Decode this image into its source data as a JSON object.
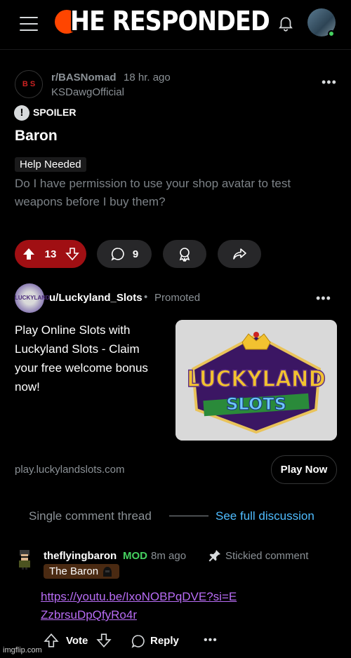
{
  "meme_caption": "HE RESPONDED",
  "post": {
    "subreddit": "r/BASNomad",
    "time": "18 hr. ago",
    "author": "KSDawgOfficial",
    "spoiler_label": "SPOILER",
    "title": "Baron",
    "flair": "Help Needed",
    "body": "Do I have permission to use your shop avatar to test weapons before I buy them?",
    "votes": "13",
    "comments": "9"
  },
  "ad": {
    "user": "u/Luckyland_Slots",
    "promoted": "Promoted",
    "text": "Play Online Slots with Luckyland Slots - Claim your free welcome bonus now!",
    "image_text_top": "LUCKYLAND",
    "image_text_bottom": "SLOTS",
    "domain": "play.luckylandslots.com",
    "cta": "Play Now"
  },
  "thread": {
    "label": "Single comment thread",
    "see_full": "See full discussion"
  },
  "comment": {
    "user": "theflyingbaron",
    "mod_badge": "MOD",
    "time": "8m ago",
    "stickied": "Stickied comment",
    "flair": "The Baron",
    "link": "https://youtu.be/IxoNOBPqDVE?si=EZzbrsuDpQfyRo4r",
    "vote_label": "Vote",
    "reply_label": "Reply"
  },
  "watermark": "imgflip.com",
  "colors": {
    "upvote_active": "#a00f13",
    "mod_green": "#46d160",
    "link_purple": "#b86cf5",
    "see_full_blue": "#4fbcff"
  }
}
